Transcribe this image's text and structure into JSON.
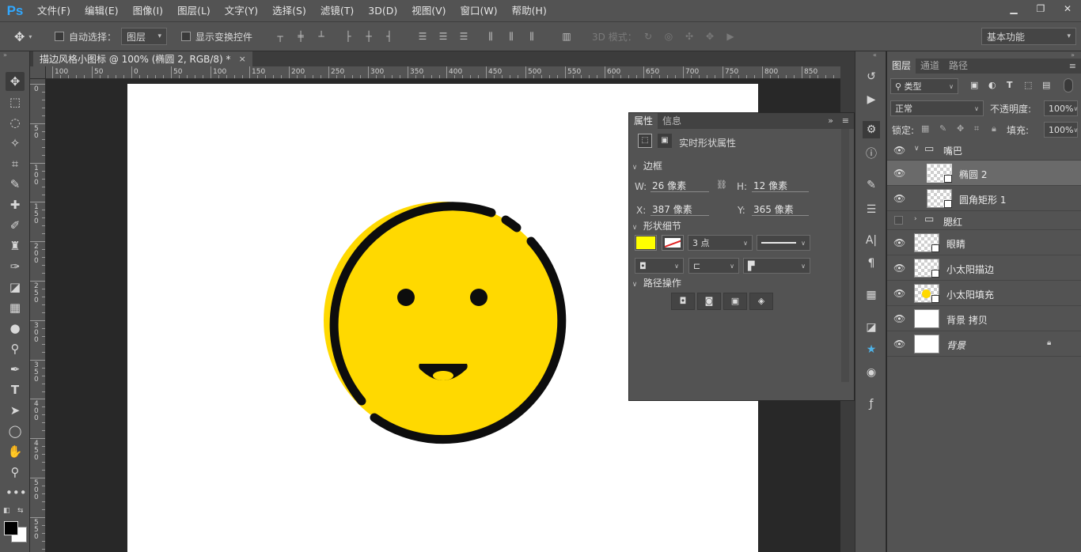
{
  "app": {
    "logo": "Ps"
  },
  "menu": [
    "文件(F)",
    "编辑(E)",
    "图像(I)",
    "图层(L)",
    "文字(Y)",
    "选择(S)",
    "滤镜(T)",
    "3D(D)",
    "视图(V)",
    "窗口(W)",
    "帮助(H)"
  ],
  "window_controls": {
    "minimize": "▁",
    "restore": "❐",
    "close": "✕"
  },
  "options": {
    "auto_select_label": "自动选择：",
    "auto_select_value": "图层",
    "show_transform_label": "显示变换控件",
    "mode_3d_label": "3D 模式：",
    "workspace": "基本功能"
  },
  "document": {
    "tab_title": "描边风格小图标 @ 100% (椭圆 2, RGB/8) *",
    "close": "×"
  },
  "ruler": {
    "h_labels": [
      "100",
      "50",
      "0",
      "50",
      "100",
      "150",
      "200",
      "250",
      "300",
      "350",
      "400",
      "450",
      "500",
      "550",
      "600",
      "650",
      "700",
      "750",
      "800",
      "850"
    ],
    "v_labels": [
      "0",
      "50",
      "100",
      "150",
      "200",
      "250",
      "300",
      "350",
      "400",
      "450",
      "500",
      "550"
    ]
  },
  "properties": {
    "tabs": [
      "属性",
      "信息"
    ],
    "title": "实时形状属性",
    "section_bounds": "边框",
    "w_label": "W:",
    "w_value": "26 像素",
    "h_label": "H:",
    "h_value": "12 像素",
    "x_label": "X:",
    "x_value": "387 像素",
    "y_label": "Y:",
    "y_value": "365 像素",
    "section_shape": "形状细节",
    "fill_color": "#ffff00",
    "stroke_width": "3 点",
    "section_path": "路径操作"
  },
  "layers": {
    "tabs": [
      "图层",
      "通道",
      "路径"
    ],
    "filter_label": "类型",
    "blend_mode": "正常",
    "opacity_label": "不透明度:",
    "opacity_value": "100%",
    "lock_label": "锁定:",
    "fill_label": "填充:",
    "fill_value": "100%",
    "items": [
      {
        "name": "嘴巴",
        "type": "group",
        "expanded": true,
        "visible": true
      },
      {
        "name": "椭圆 2",
        "type": "shape",
        "selected": true,
        "visible": true
      },
      {
        "name": "圆角矩形 1",
        "type": "shape",
        "visible": true
      },
      {
        "name": "腮红",
        "type": "group",
        "expanded": false,
        "visible": false
      },
      {
        "name": "眼睛",
        "type": "shape",
        "visible": true
      },
      {
        "name": "小太阳描边",
        "type": "shape",
        "visible": true
      },
      {
        "name": "小太阳填充",
        "type": "shape",
        "visible": true
      },
      {
        "name": "背景 拷贝",
        "type": "pixel",
        "visible": true
      },
      {
        "name": "背景",
        "type": "background",
        "locked": true,
        "visible": true
      }
    ]
  },
  "colors": {
    "face_fill": "#ffd900",
    "outline": "#0d0d0d",
    "mouth_tongue": "#ffd900"
  }
}
